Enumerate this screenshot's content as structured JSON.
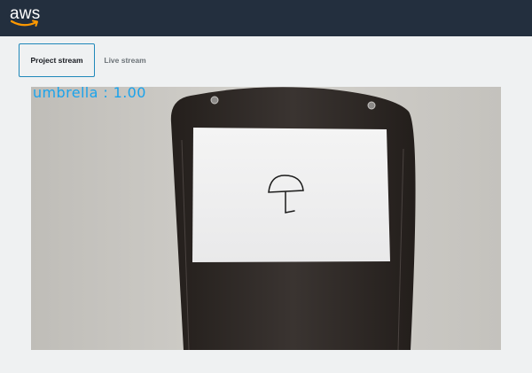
{
  "header": {
    "logo_text": "aws",
    "logo_icon": "aws-smile-logo"
  },
  "tabs": [
    {
      "label": "Project stream",
      "active": true
    },
    {
      "label": "Live stream",
      "active": false
    }
  ],
  "stream": {
    "detection_label": "umbrella : 1.00",
    "label_color": "#1aa3ec",
    "drawing_icon": "umbrella-sketch"
  },
  "colors": {
    "header_bg": "#232f3e",
    "accent": "#1f88ba",
    "logo_smile": "#ff9900"
  }
}
